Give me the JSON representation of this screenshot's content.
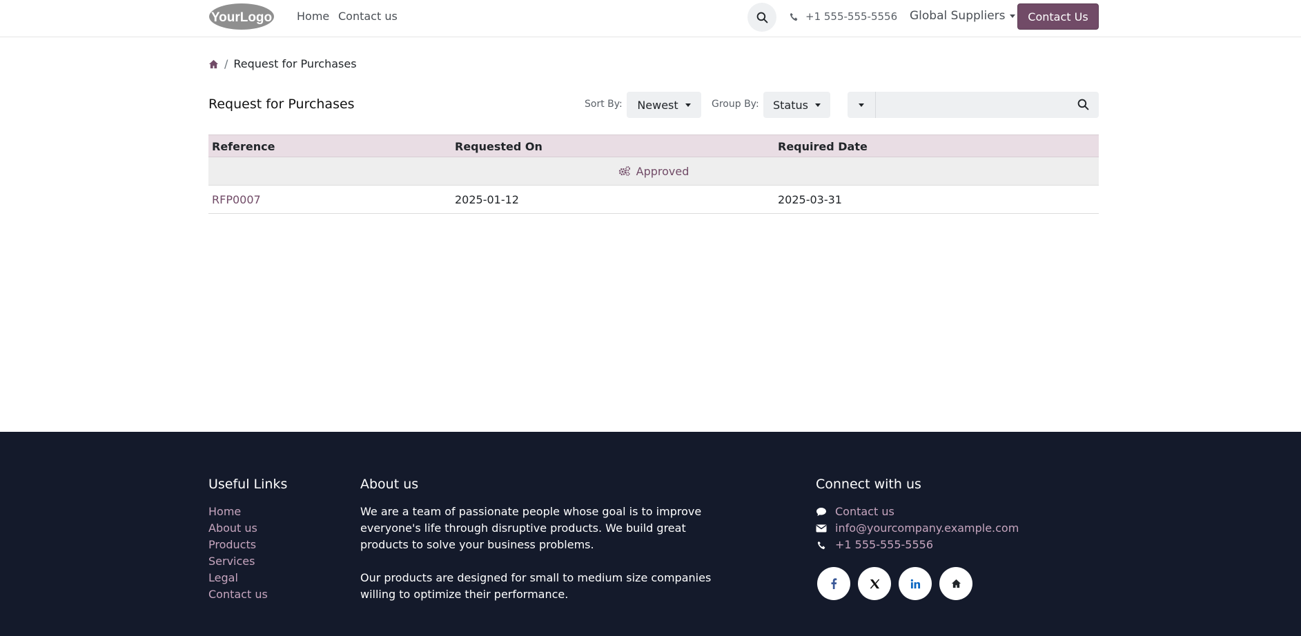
{
  "header": {
    "logo_text": "YourLogo",
    "nav": [
      "Home",
      "Contact us"
    ],
    "phone": "+1 555-555-5556",
    "company": "Global Suppliers",
    "contact_button": "Contact Us"
  },
  "breadcrumb": {
    "current": "Request for Purchases"
  },
  "toolbar": {
    "title": "Request for Purchases",
    "sort_label": "Sort By:",
    "sort_value": "Newest",
    "group_label": "Group By:",
    "group_value": "Status",
    "search_value": ""
  },
  "table": {
    "columns": [
      "Reference",
      "Requested On",
      "Required Date"
    ],
    "group": "Approved",
    "rows": [
      {
        "reference": "RFP0007",
        "requested_on": "2025-01-12",
        "required_date": "2025-03-31"
      }
    ]
  },
  "footer": {
    "useful_links_title": "Useful Links",
    "useful_links": [
      "Home",
      "About us",
      "Products",
      "Services",
      "Legal",
      "Contact us"
    ],
    "about_title": "About us",
    "about_p1": "We are a team of passionate people whose goal is to improve everyone's life through disruptive products. We build great products to solve your business problems.",
    "about_p2": "Our products are designed for small to medium size companies willing to optimize their performance.",
    "connect_title": "Connect with us",
    "connect_contact": "Contact us",
    "connect_email": "info@yourcompany.example.com",
    "connect_phone": "+1 555-555-5556",
    "socials": [
      "facebook-icon",
      "x-twitter-icon",
      "linkedin-icon",
      "home-icon"
    ]
  },
  "colors": {
    "brand": "#714b67",
    "footer_bg": "#141a2b",
    "table_header_bg": "#e9dde4",
    "link_light": "#c7a6bf"
  }
}
